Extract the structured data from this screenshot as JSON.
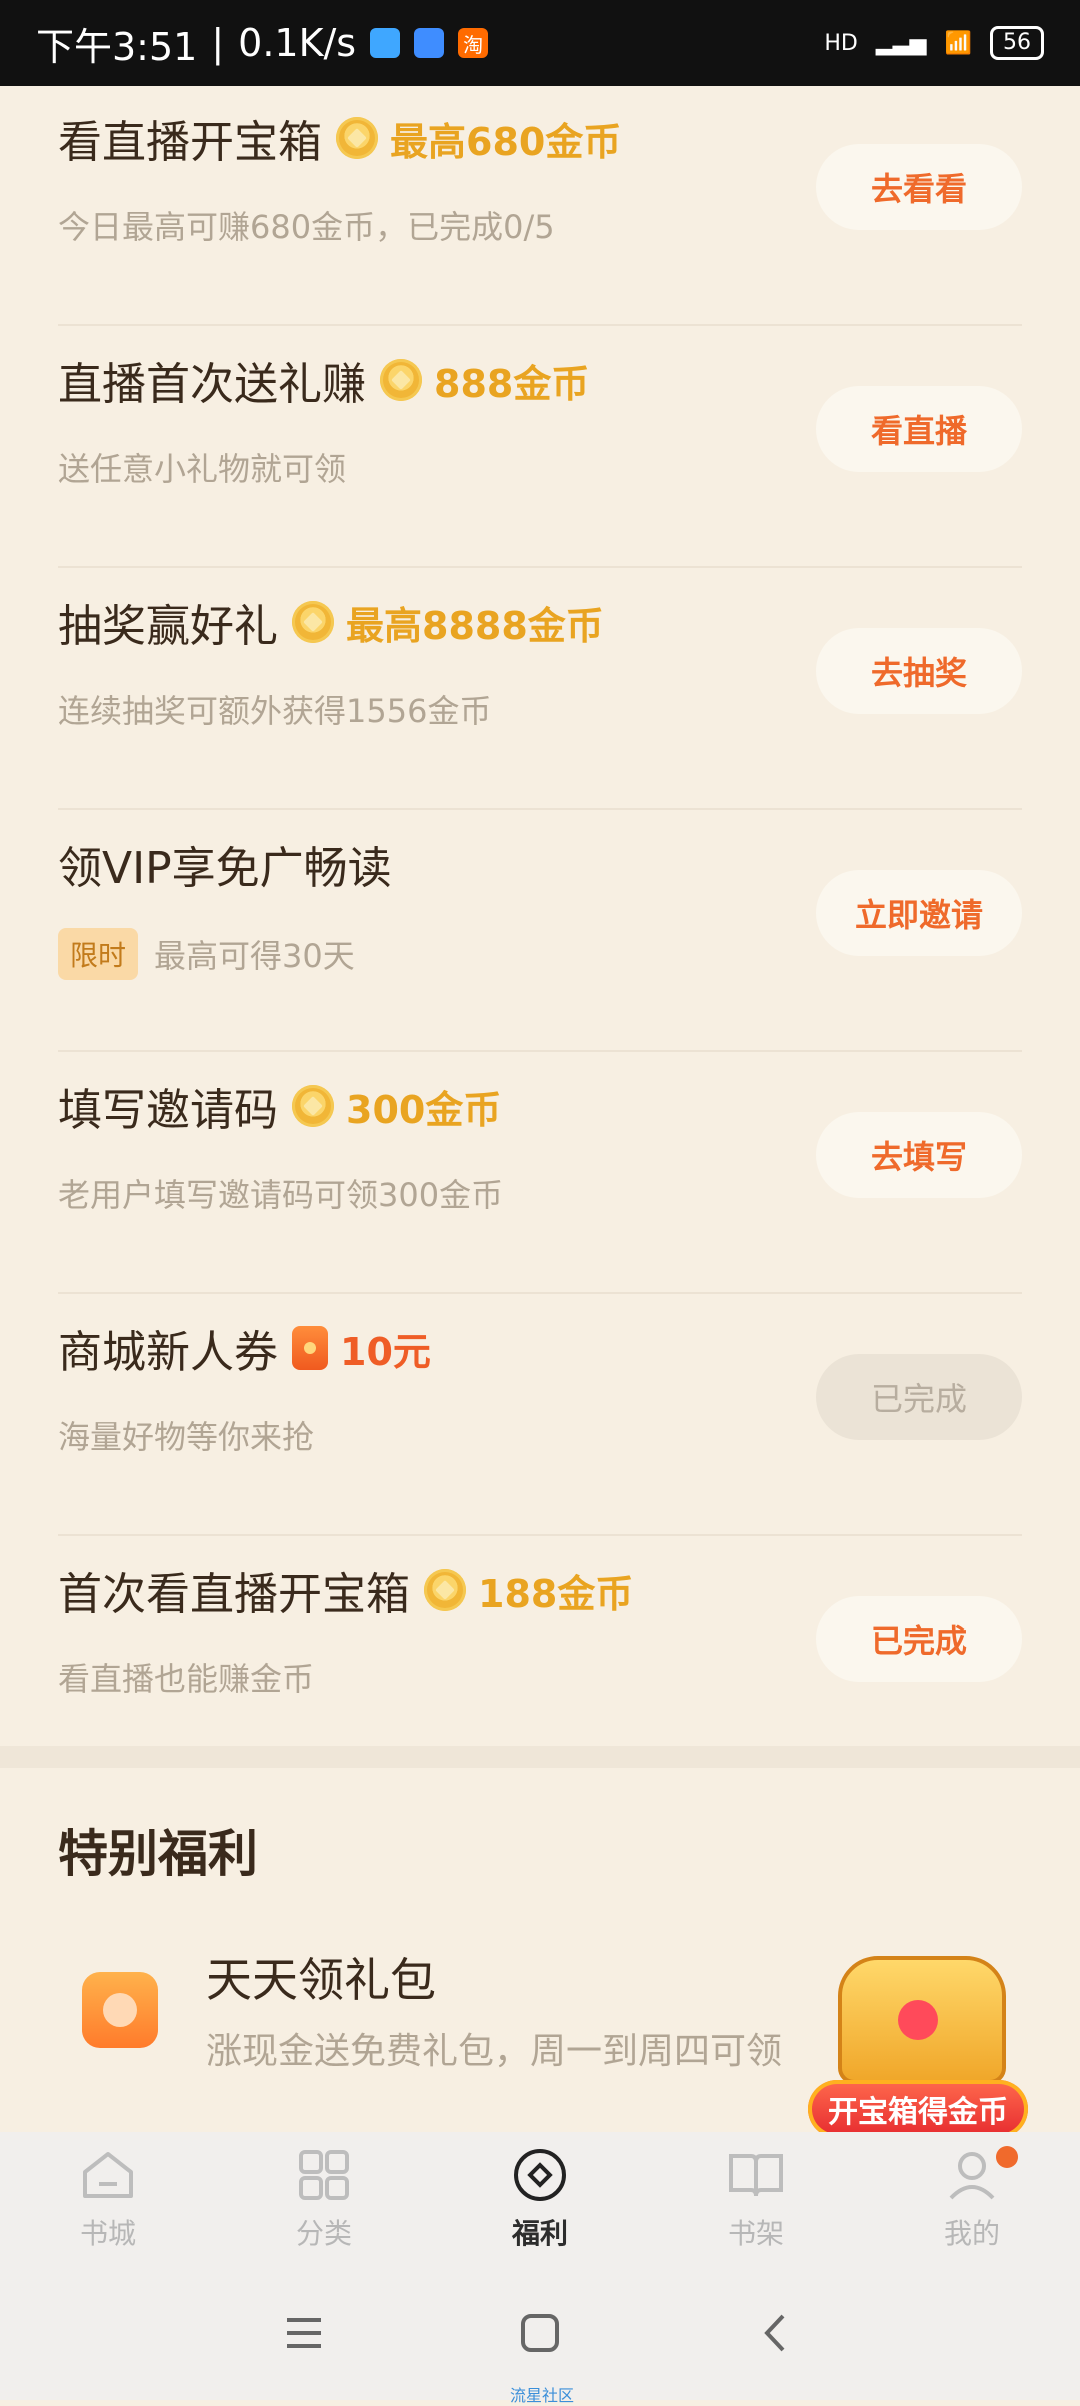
{
  "status_bar": {
    "time": "下午3:51",
    "speed": "0.1K/s",
    "network": "HD",
    "battery": "56",
    "apps": [
      {
        "name": "app1",
        "color": "#3fa7ff"
      },
      {
        "name": "app2",
        "color": "#3f8dff"
      },
      {
        "name": "淘",
        "color": "#ff6b00"
      }
    ]
  },
  "tasks": [
    {
      "title": "看直播开宝箱",
      "reward": "最高680金币",
      "reward_icon": "coin-icon",
      "subtitle": "今日最高可赚680金币，已完成0/5",
      "button": "去看看",
      "button_state": "active"
    },
    {
      "title": "直播首次送礼赚",
      "reward": "888金币",
      "reward_icon": "coin-icon",
      "subtitle": "送任意小礼物就可领",
      "button": "看直播",
      "button_state": "active"
    },
    {
      "title": "抽奖赢好礼",
      "reward": "最高8888金币",
      "reward_icon": "coin-icon",
      "subtitle": "连续抽奖可额外获得1556金币",
      "button": "去抽奖",
      "button_state": "active"
    },
    {
      "title": "领VIP享免广畅读",
      "reward": "",
      "reward_icon": "",
      "badge": "限时",
      "subtitle": "最高可得30天",
      "button": "立即邀请",
      "button_state": "active"
    },
    {
      "title": "填写邀请码",
      "reward": "300金币",
      "reward_icon": "coin-icon",
      "subtitle": "老用户填写邀请码可领300金币",
      "button": "去填写",
      "button_state": "active"
    },
    {
      "title": "商城新人券",
      "reward": "10元",
      "reward_icon": "red-packet-icon",
      "subtitle": "海量好物等你来抢",
      "button": "已完成",
      "button_state": "disabled"
    },
    {
      "title": "首次看直播开宝箱",
      "reward": "188金币",
      "reward_icon": "coin-icon",
      "subtitle": "看直播也能赚金币",
      "button": "已完成",
      "button_state": "done"
    }
  ],
  "special": {
    "title": "特别福利",
    "item_title": "天天领礼包",
    "item_sub": "涨现金送免费礼包，周一到周四可领"
  },
  "treasure": {
    "label": "开宝箱得金币"
  },
  "bottom_nav": [
    {
      "label": "书城",
      "icon": "home-icon",
      "active": false
    },
    {
      "label": "分类",
      "icon": "grid-icon",
      "active": false
    },
    {
      "label": "福利",
      "icon": "coin-tab-icon",
      "active": true
    },
    {
      "label": "书架",
      "icon": "book-icon",
      "active": false
    },
    {
      "label": "我的",
      "icon": "user-icon",
      "active": false
    }
  ],
  "watermark": "流星社区"
}
